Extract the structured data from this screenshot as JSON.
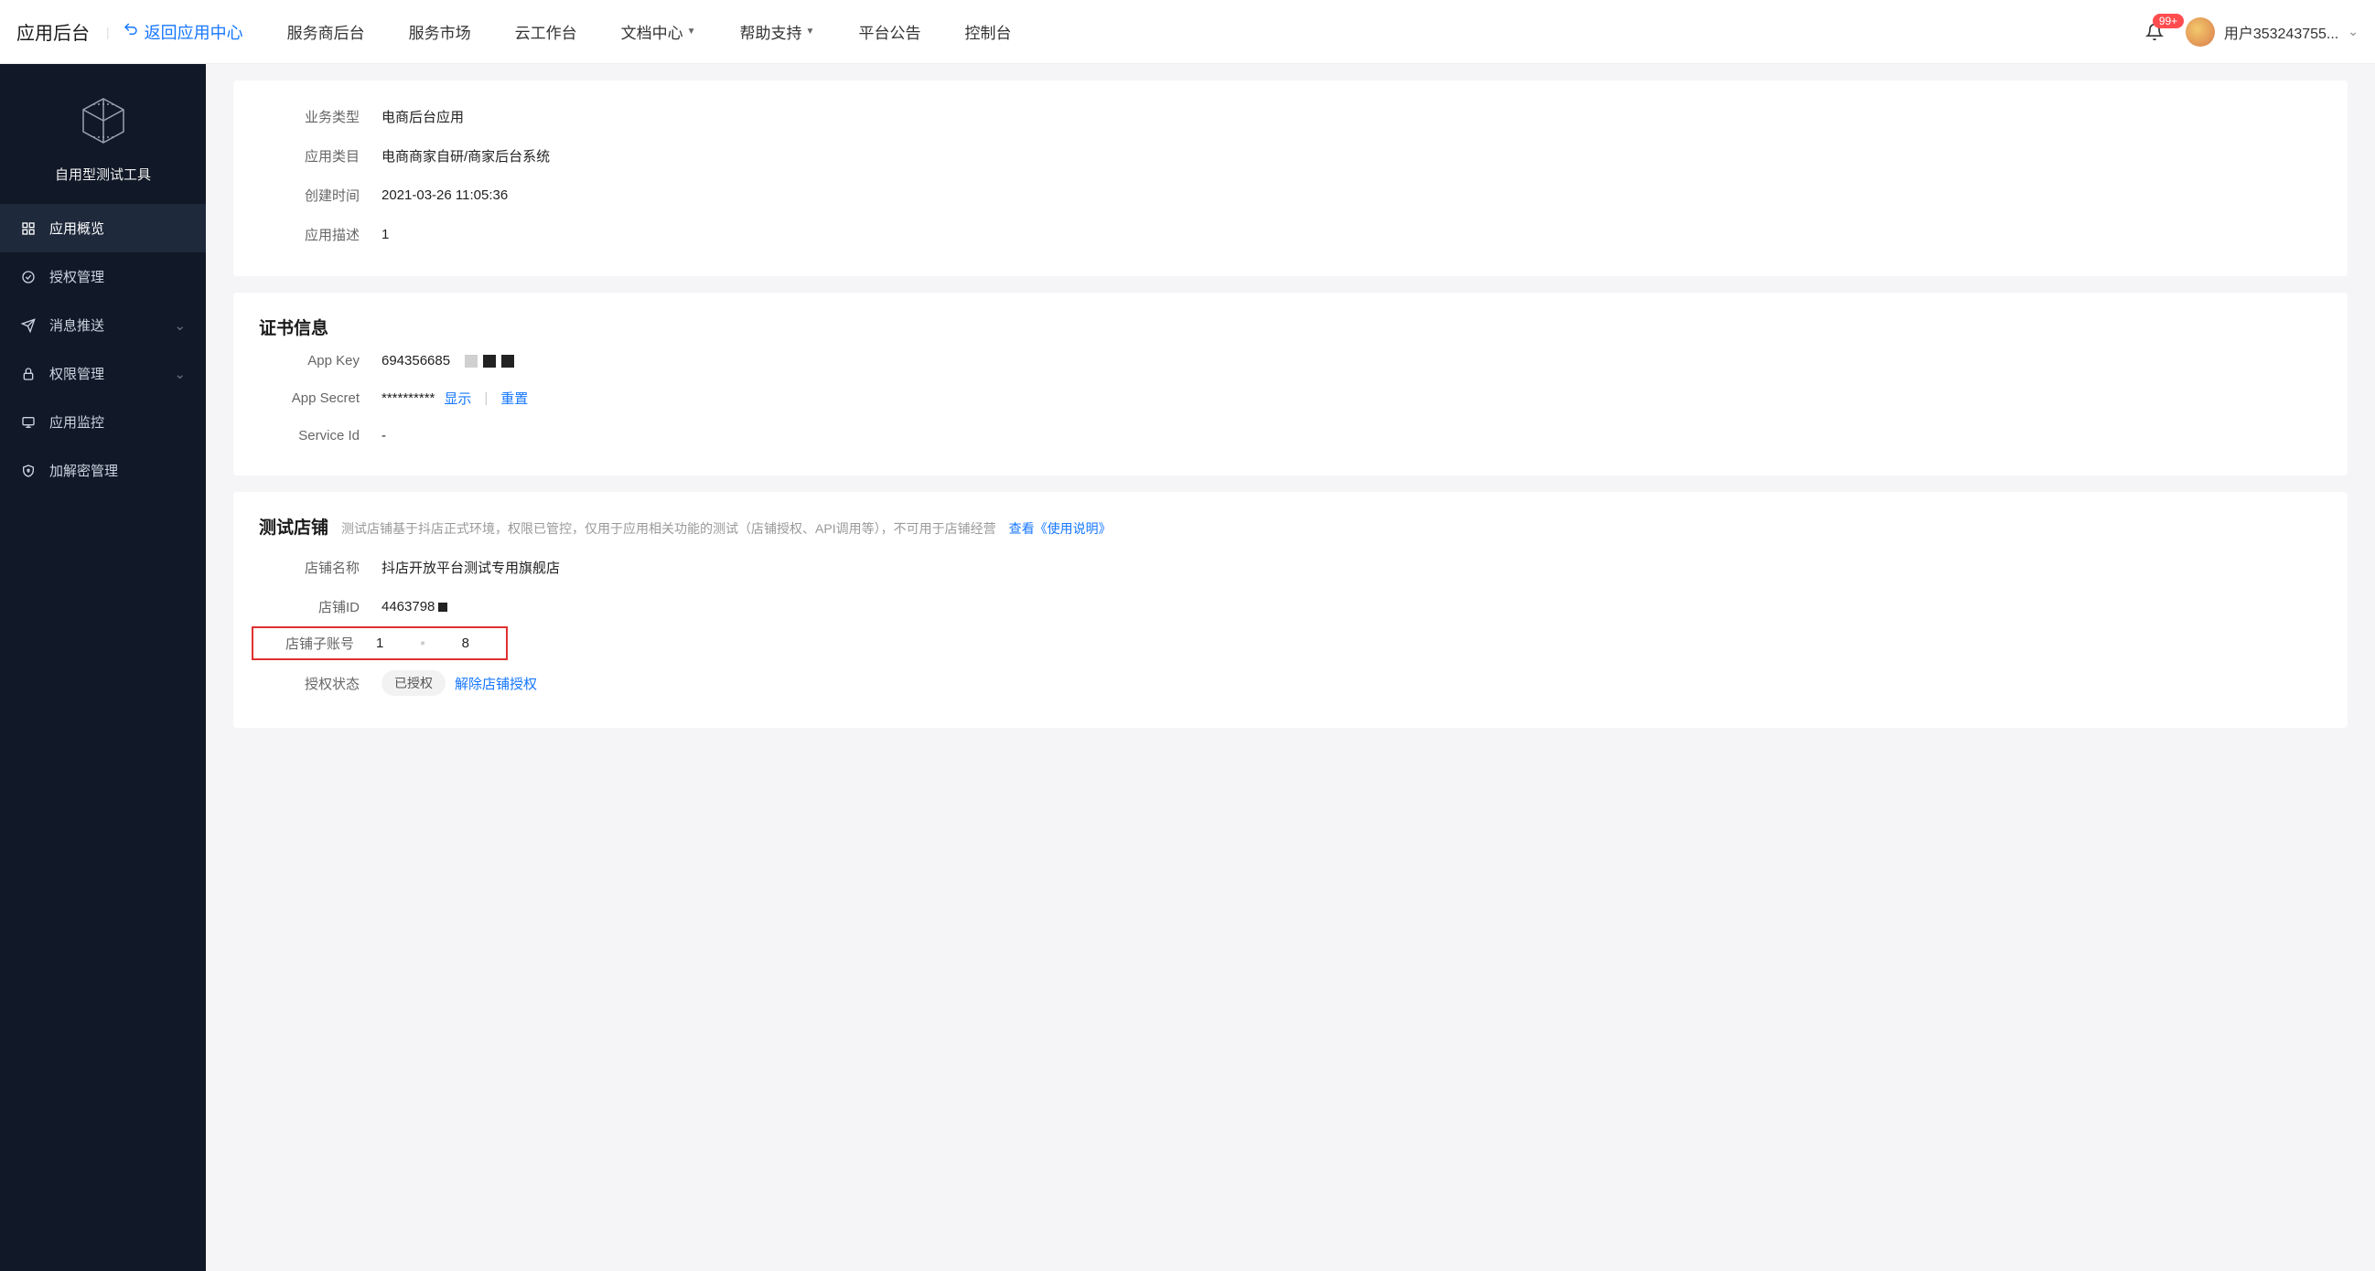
{
  "header": {
    "title": "应用后台",
    "back_label": "返回应用中心",
    "nav": [
      {
        "label": "服务商后台",
        "has_dropdown": false
      },
      {
        "label": "服务市场",
        "has_dropdown": false
      },
      {
        "label": "云工作台",
        "has_dropdown": false
      },
      {
        "label": "文档中心",
        "has_dropdown": true
      },
      {
        "label": "帮助支持",
        "has_dropdown": true
      },
      {
        "label": "平台公告",
        "has_dropdown": false
      },
      {
        "label": "控制台",
        "has_dropdown": false
      }
    ],
    "badge_count": "99+",
    "user_name": "用户353243755..."
  },
  "sidebar": {
    "app_name": "自用型测试工具",
    "items": [
      {
        "label": "应用概览",
        "icon": "grid-icon",
        "active": true,
        "expandable": false
      },
      {
        "label": "授权管理",
        "icon": "check-circle-icon",
        "active": false,
        "expandable": false
      },
      {
        "label": "消息推送",
        "icon": "send-icon",
        "active": false,
        "expandable": true
      },
      {
        "label": "权限管理",
        "icon": "lock-icon",
        "active": false,
        "expandable": true
      },
      {
        "label": "应用监控",
        "icon": "monitor-icon",
        "active": false,
        "expandable": false
      },
      {
        "label": "加解密管理",
        "icon": "shield-icon",
        "active": false,
        "expandable": false
      }
    ]
  },
  "app_info": {
    "rows": {
      "business_type": {
        "label": "业务类型",
        "value": "电商后台应用"
      },
      "app_category": {
        "label": "应用类目",
        "value": "电商商家自研/商家后台系统"
      },
      "created_at": {
        "label": "创建时间",
        "value": "2021-03-26 11:05:36"
      },
      "description": {
        "label": "应用描述",
        "value": "1"
      }
    }
  },
  "cert": {
    "title": "证书信息",
    "rows": {
      "app_key": {
        "label": "App Key",
        "value": "694356685"
      },
      "app_secret": {
        "label": "App Secret",
        "value": "**********",
        "show_label": "显示",
        "reset_label": "重置"
      },
      "service_id": {
        "label": "Service Id",
        "value": "-"
      }
    }
  },
  "test_store": {
    "title": "测试店铺",
    "hint": "测试店铺基于抖店正式环境，权限已管控，仅用于应用相关功能的测试（店铺授权、API调用等），不可用于店铺经营",
    "guide_link": "查看《使用说明》",
    "rows": {
      "name": {
        "label": "店铺名称",
        "value": "抖店开放平台测试专用旗舰店"
      },
      "store_id": {
        "label": "店铺ID",
        "value": "4463798"
      },
      "sub_account": {
        "label": "店铺子账号",
        "value_start": "1",
        "value_end": "8"
      },
      "auth_status": {
        "label": "授权状态",
        "badge": "已授权",
        "unlink_label": "解除店铺授权"
      }
    }
  }
}
